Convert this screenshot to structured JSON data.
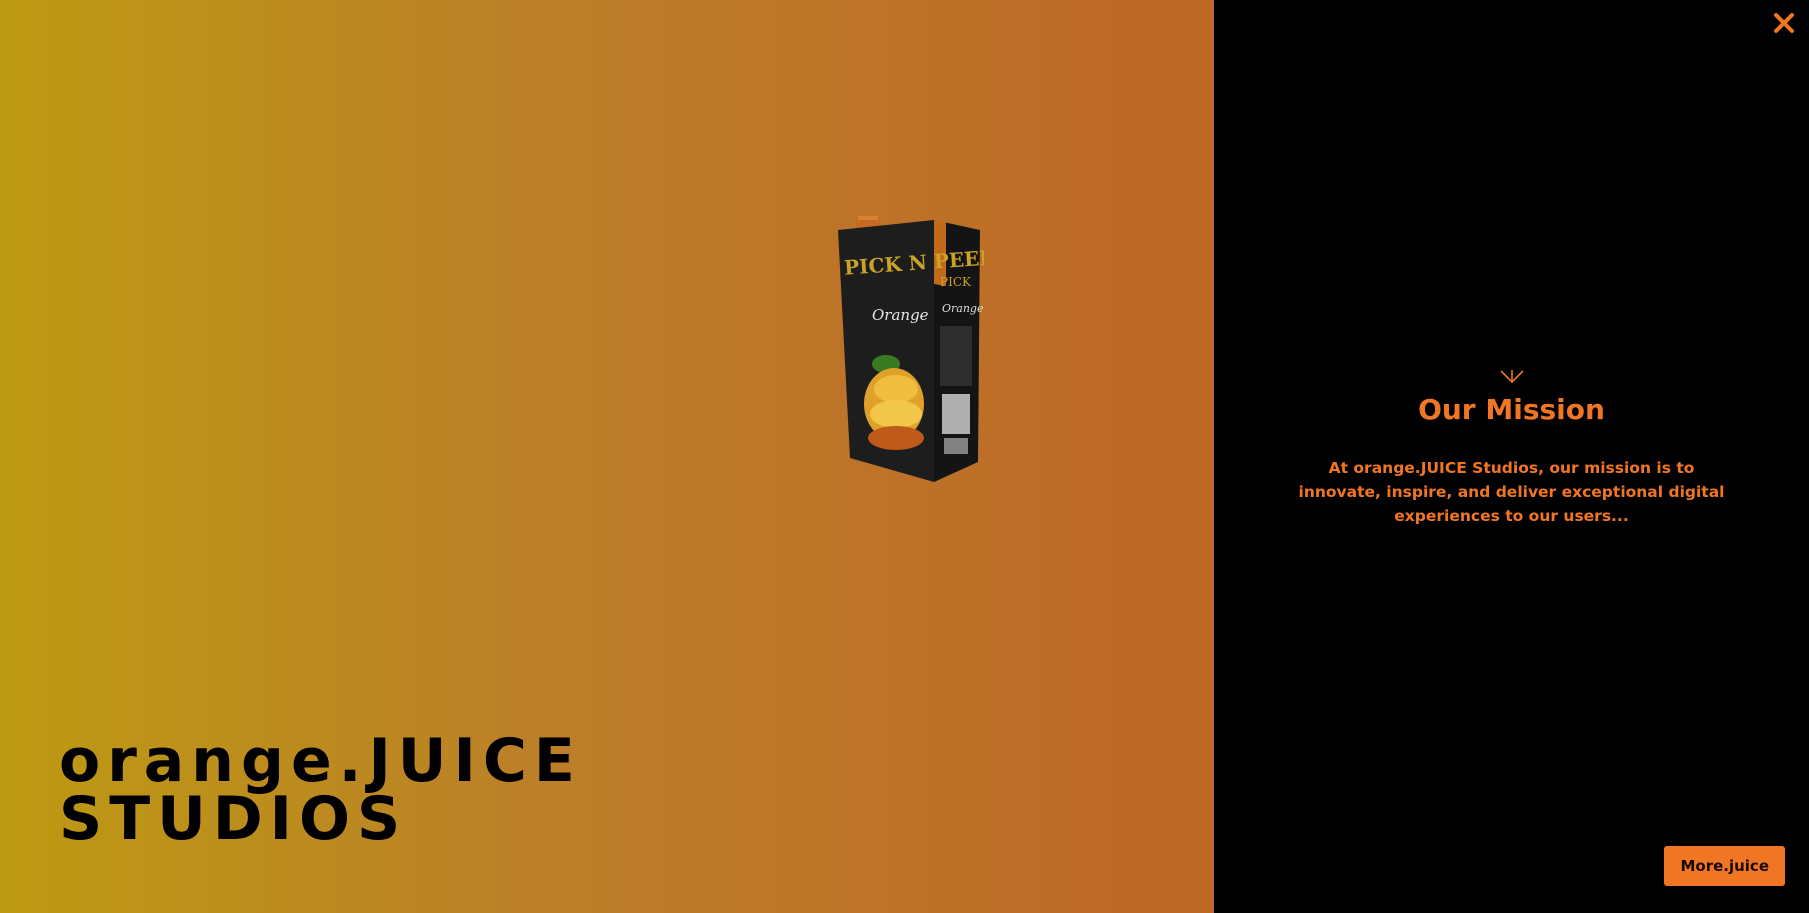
{
  "hero": {
    "title_line1": "orange.JUICE",
    "title_line2": "STUDIOS",
    "product_image": "pick-n-peel-orange-juice-carton"
  },
  "panel": {
    "close_icon": "close-icon",
    "arrow_icon": "chevron-down-icon",
    "mission_title": "Our Mission",
    "mission_text": "At orange.JUICE Studios, our mission is to innovate, inspire, and deliver exceptional digital experiences to our users...",
    "more_button_label": "More.juice"
  },
  "colors": {
    "accent": "#f07624",
    "panel_background": "#000000",
    "hero_gradient_start": "#bd9a12",
    "hero_gradient_end": "#be6727"
  }
}
